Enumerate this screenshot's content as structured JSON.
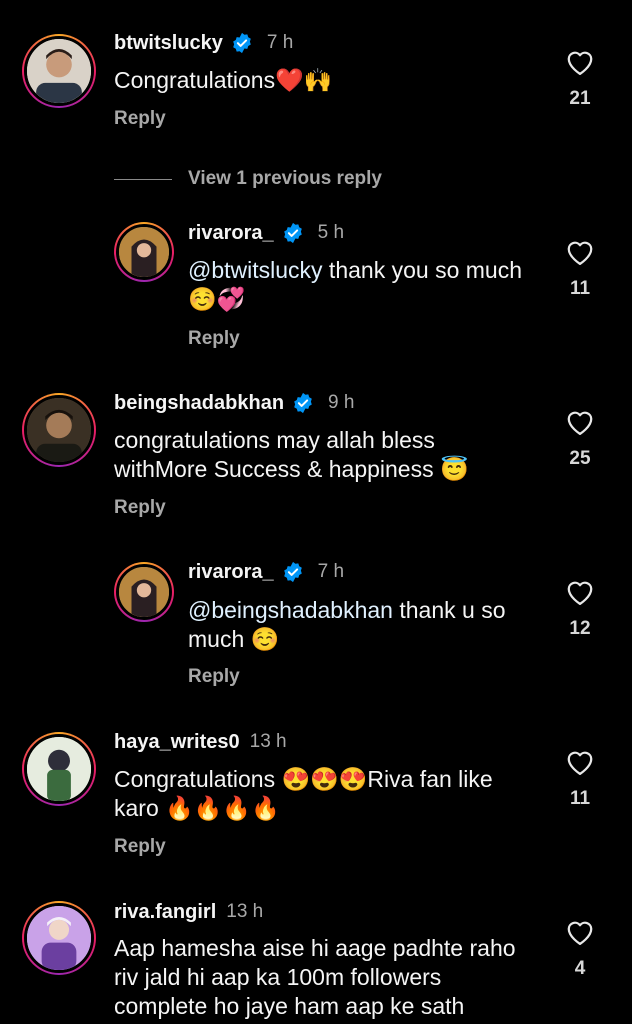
{
  "comments": [
    {
      "user": "btwitslucky",
      "verified": true,
      "time": "7 h",
      "text": "Congratulations❤️🙌",
      "reply": "Reply",
      "likes": "21",
      "avatar_colors": [
        "#e8dcd0",
        "#2b3645"
      ]
    },
    {
      "user": "rivarora_",
      "verified": true,
      "time": "5 h",
      "mention": "@btwitslucky",
      "text": " thank you so much ☺️💞",
      "reply": "Reply",
      "likes": "11",
      "avatar_colors": [
        "#c8a35f",
        "#2a1f22"
      ]
    },
    {
      "user": "beingshadabkhan",
      "verified": true,
      "time": "9 h",
      "text": "congratulations may allah bless withMore Success & happiness 😇",
      "reply": "Reply",
      "likes": "25",
      "avatar_colors": [
        "#6e5a3e",
        "#1a1a14"
      ]
    },
    {
      "user": "rivarora_",
      "verified": true,
      "time": "7 h",
      "mention": "@beingshadabkhan",
      "text": " thank u so much ☺️",
      "reply": "Reply",
      "likes": "12",
      "avatar_colors": [
        "#c8a35f",
        "#2a1f22"
      ]
    },
    {
      "user": "haya_writes0",
      "verified": false,
      "time": "13 h",
      "text": "Congratulations 😍😍😍Riva fan like karo 🔥🔥🔥🔥",
      "reply": "Reply",
      "likes": "11",
      "avatar_colors": [
        "#cfe2c8",
        "#3b6b3e"
      ]
    },
    {
      "user": "riva.fangirl",
      "verified": false,
      "time": "13 h",
      "text": "Aap hamesha aise hi aage padhte raho riv jald hi aap ka 100m followers complete ho jaye ham aap ke sath",
      "reply": "",
      "likes": "4",
      "avatar_colors": [
        "#d6b7f0",
        "#6b3fa0"
      ]
    }
  ],
  "view_previous": "View 1 previous reply",
  "colors": {
    "verified": "#0095f6",
    "background": "#000000",
    "muted": "#a8a8a8"
  }
}
